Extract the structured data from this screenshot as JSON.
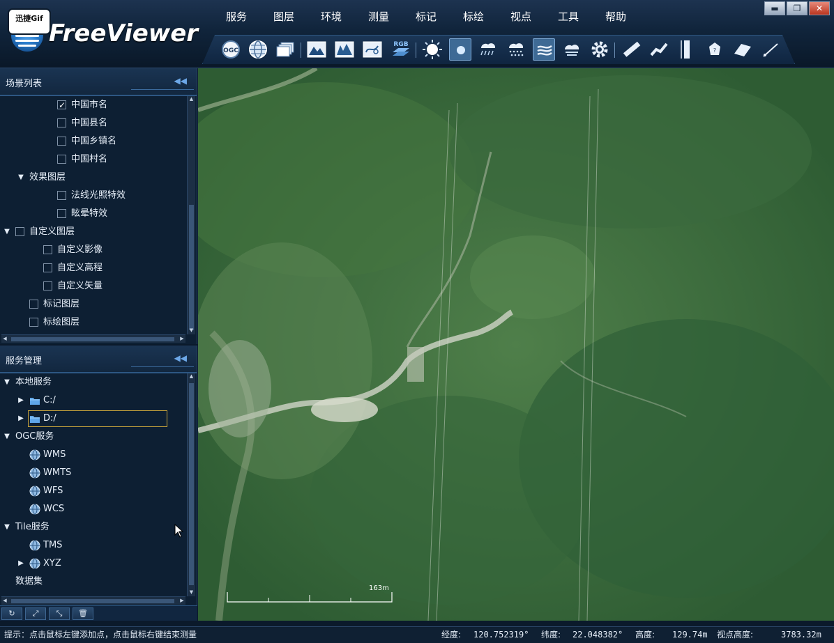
{
  "app": {
    "title": "FreeViewer",
    "badge": "迅捷Gif"
  },
  "window_controls": {
    "minimize": "▬",
    "restore": "❐",
    "close": "✕"
  },
  "menu": [
    "服务",
    "图层",
    "环境",
    "测量",
    "标记",
    "标绘",
    "视点",
    "工具",
    "帮助"
  ],
  "toolbar": {
    "buttons": [
      "ogc-icon",
      "globe-icon",
      "layers-stack-icon",
      "image-terrain-icon",
      "elevation-icon",
      "vector-map-icon",
      "rgb-layer-icon",
      "sun-icon",
      "sky-sphere-icon",
      "rain-icon",
      "snow-icon",
      "fog-icon",
      "cloud-icon",
      "settings-gear-icon",
      "ruler-distance-icon",
      "ruler-path-icon",
      "ruler-height-icon",
      "area-polygon-icon",
      "profile-icon",
      "pen-icon"
    ],
    "labels": {
      "ogc": "OGC",
      "rgb": "RGB"
    },
    "active": [
      "sky-sphere-icon",
      "fog-icon"
    ]
  },
  "scene_panel": {
    "title": "场景列表",
    "collapse": "◀◀",
    "items": [
      {
        "label": "中国市名",
        "level": 3,
        "checked": true,
        "arrow": ""
      },
      {
        "label": "中国县名",
        "level": 3,
        "checked": false,
        "arrow": ""
      },
      {
        "label": "中国乡镇名",
        "level": 3,
        "checked": false,
        "arrow": ""
      },
      {
        "label": "中国村名",
        "level": 3,
        "checked": false,
        "arrow": ""
      },
      {
        "label": "效果图层",
        "level": 1,
        "checked": null,
        "arrow": "▼"
      },
      {
        "label": "法线光照特效",
        "level": 3,
        "checked": false,
        "arrow": ""
      },
      {
        "label": "眩晕特效",
        "level": 3,
        "checked": false,
        "arrow": ""
      },
      {
        "label": "自定义图层",
        "level": 0,
        "checked": false,
        "arrow": "▼"
      },
      {
        "label": "自定义影像",
        "level": 2,
        "checked": false,
        "arrow": ""
      },
      {
        "label": "自定义高程",
        "level": 2,
        "checked": false,
        "arrow": ""
      },
      {
        "label": "自定义矢量",
        "level": 2,
        "checked": false,
        "arrow": ""
      },
      {
        "label": "标记图层",
        "level": 1,
        "checked": false,
        "arrow": ""
      },
      {
        "label": "标绘图层",
        "level": 1,
        "checked": false,
        "arrow": ""
      }
    ]
  },
  "service_panel": {
    "title": "服务管理",
    "collapse": "◀◀",
    "items": [
      {
        "label": "本地服务",
        "level": 0,
        "arrow": "▼",
        "icon": ""
      },
      {
        "label": "C:/",
        "level": 1,
        "arrow": "▶",
        "icon": "folder-icon"
      },
      {
        "label": "D:/",
        "level": 1,
        "arrow": "▶",
        "icon": "folder-icon",
        "selected": true
      },
      {
        "label": "OGC服务",
        "level": 0,
        "arrow": "▼",
        "icon": ""
      },
      {
        "label": "WMS",
        "level": 1,
        "arrow": "",
        "icon": "globe-icon"
      },
      {
        "label": "WMTS",
        "level": 1,
        "arrow": "",
        "icon": "globe-icon"
      },
      {
        "label": "WFS",
        "level": 1,
        "arrow": "",
        "icon": "globe-icon"
      },
      {
        "label": "WCS",
        "level": 1,
        "arrow": "",
        "icon": "globe-icon"
      },
      {
        "label": "Tile服务",
        "level": 0,
        "arrow": "▼",
        "icon": ""
      },
      {
        "label": "TMS",
        "level": 1,
        "arrow": "",
        "icon": "globe-icon"
      },
      {
        "label": "XYZ",
        "level": 1,
        "arrow": "▶",
        "icon": "globe-icon"
      },
      {
        "label": "数据集",
        "level": 0,
        "arrow": "",
        "icon": ""
      }
    ],
    "footer_buttons": [
      {
        "name": "refresh-icon",
        "glyph": "↻"
      },
      {
        "name": "expand-icon",
        "glyph": "⤢"
      },
      {
        "name": "collapse-icon",
        "glyph": "⤡"
      },
      {
        "name": "trash-icon",
        "glyph": "🗑"
      }
    ]
  },
  "map": {
    "scale_label": "163m"
  },
  "status": {
    "hint": "提示：点击鼠标左键添加点，点击鼠标右键结束测量",
    "longitude_label": "经度:",
    "longitude": "120.752319°",
    "latitude_label": "纬度:",
    "latitude": "22.048382°",
    "height_label": "高度:",
    "height": "129.74m",
    "view_height_label": "视点高度:",
    "view_height": "3783.32m"
  },
  "colors": {
    "accent": "#2d5783",
    "panel_bg": "#0d1f33",
    "selection": "#c9a43b"
  }
}
